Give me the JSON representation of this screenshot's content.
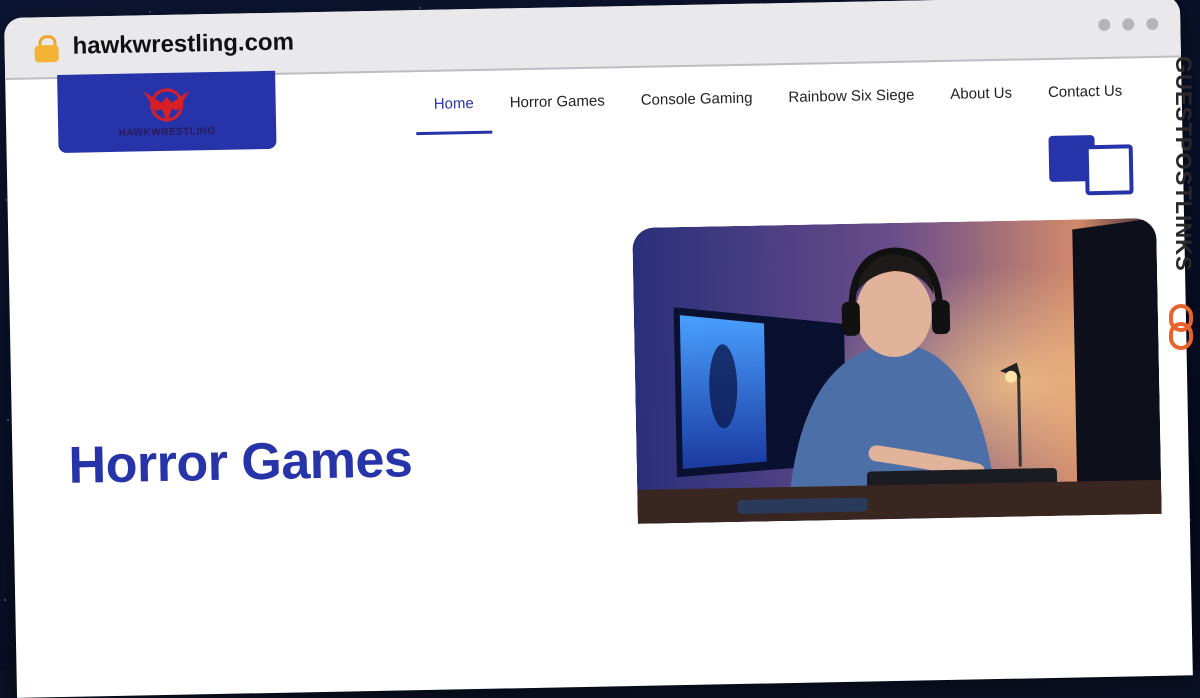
{
  "browser": {
    "url": "hawkwrestling.com"
  },
  "site": {
    "logo_text": "HAWKWRESTLING"
  },
  "nav": {
    "items": [
      {
        "label": "Home",
        "active": true
      },
      {
        "label": "Horror Games",
        "active": false
      },
      {
        "label": "Console Gaming",
        "active": false
      },
      {
        "label": "Rainbow Six Siege",
        "active": false
      },
      {
        "label": "About Us",
        "active": false
      },
      {
        "label": "Contact Us",
        "active": false
      }
    ]
  },
  "hero": {
    "title": "Horror Games"
  },
  "watermark": {
    "text": "GUESTPOSTLINKS"
  },
  "colors": {
    "accent": "#2733a8",
    "watermark_orange": "#e8632c"
  }
}
